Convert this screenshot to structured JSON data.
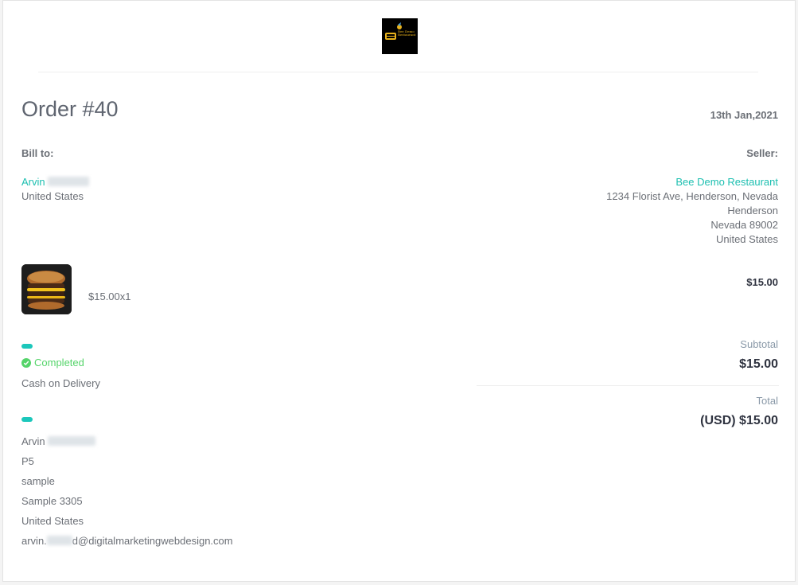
{
  "order": {
    "title": "Order #40",
    "date": "13th Jan,2021"
  },
  "brand": {
    "logo_text": "Bee Demo Restaurant"
  },
  "bill_to": {
    "heading": "Bill to:",
    "first_name": "Arvin",
    "country": "United States"
  },
  "seller": {
    "heading": "Seller:",
    "name": "Bee Demo Restaurant",
    "address_line1": "1234 Florist Ave, Henderson, Nevada",
    "city": "Henderson",
    "state_zip": "Nevada 89002",
    "country": "United States"
  },
  "item": {
    "image_icon": "burger-image",
    "price_qty": "$15.00x1",
    "line_total": "$15.00"
  },
  "status": {
    "label": "Completed",
    "icon": "check-circle-icon",
    "payment_method": "Cash on Delivery"
  },
  "shipping": {
    "first_name": "Arvin",
    "line1": "P5",
    "line2": "sample",
    "line3": "Sample 3305",
    "country": "United States",
    "email_prefix": "arvin.",
    "email_suffix": "d@digitalmarketingwebdesign.com"
  },
  "totals": {
    "subtotal_label": "Subtotal",
    "subtotal_value": "$15.00",
    "total_label": "Total",
    "total_value": "(USD) $15.00"
  },
  "colors": {
    "accent": "#1cbfb0",
    "status_green": "#55d46a",
    "pill": "#1cc7bb"
  }
}
